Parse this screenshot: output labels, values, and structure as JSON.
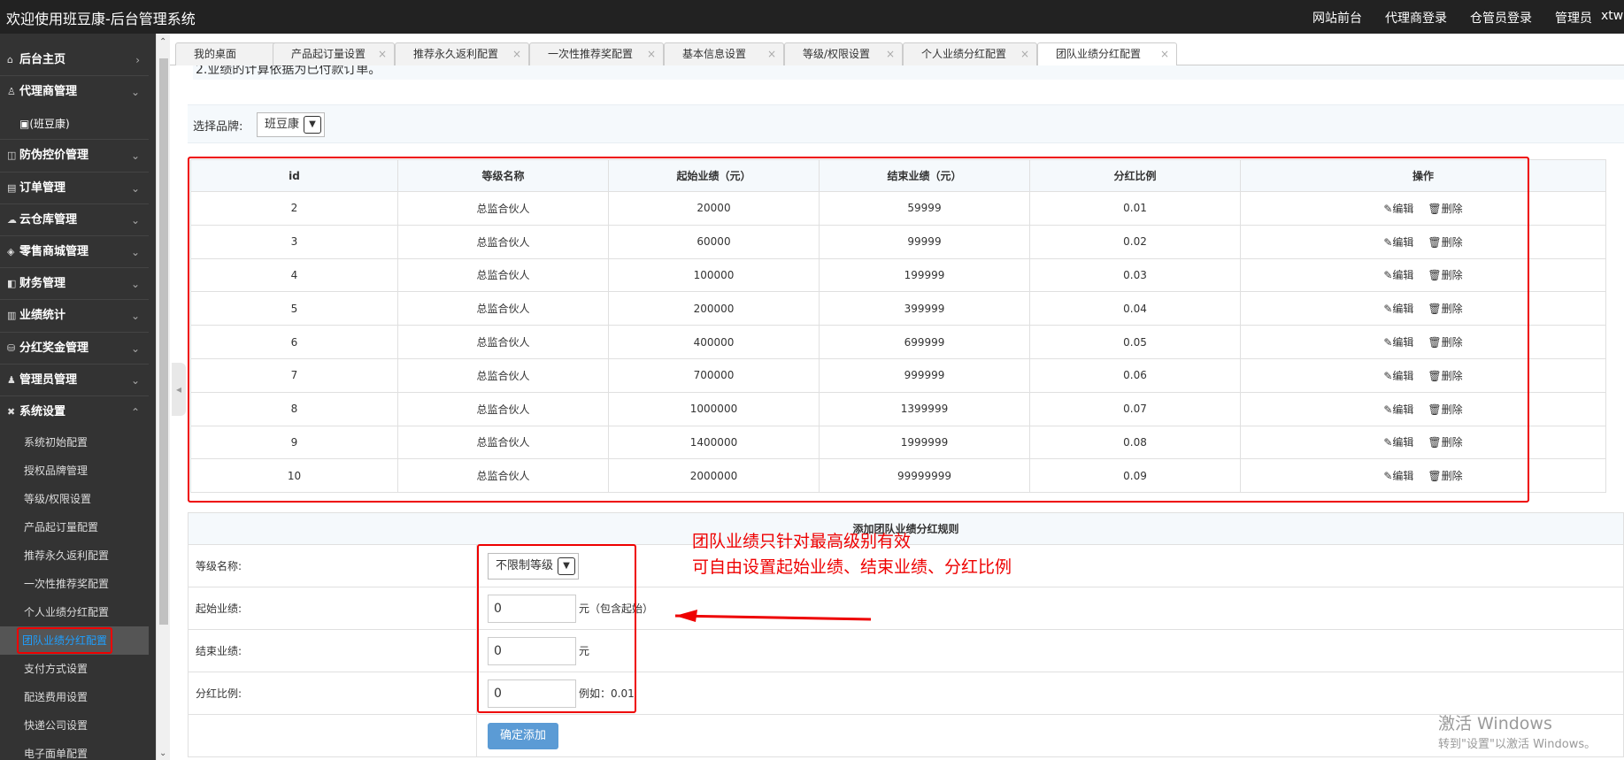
{
  "app": {
    "title": "欢迎使用班豆康-后台管理系统"
  },
  "topnav": [
    "网站前台",
    "代理商登录",
    "仓管员登录",
    "管理员"
  ],
  "user": "xtw",
  "menu": {
    "home": "后台主页",
    "agent": "代理商管理",
    "agent_sub": "(班豆康)",
    "anti": "防伪控价管理",
    "order": "订单管理",
    "cloud": "云仓库管理",
    "retail": "零售商城管理",
    "finance": "财务管理",
    "perf": "业绩统计",
    "bonus": "分红奖金管理",
    "admin": "管理员管理",
    "system": "系统设置",
    "sys_items": [
      "系统初始配置",
      "授权品牌管理",
      "等级/权限设置",
      "产品起订量配置",
      "推荐永久返利配置",
      "一次性推荐奖配置",
      "个人业绩分红配置",
      "团队业绩分红配置",
      "支付方式设置",
      "配送费用设置",
      "快递公司设置",
      "电子面单配置"
    ]
  },
  "tabs": [
    "我的桌面",
    "产品起订量设置",
    "推荐永久返利配置",
    "一次性推荐奖配置",
    "基本信息设置",
    "等级/权限设置",
    "个人业绩分红配置",
    "团队业绩分红配置"
  ],
  "note": "2.业绩的计算依据为已付款订单。",
  "brand": {
    "label": "选择品牌:",
    "value": "班豆康"
  },
  "table": {
    "headers": [
      "id",
      "等级名称",
      "起始业绩（元）",
      "结束业绩（元）",
      "分红比例",
      "操作"
    ],
    "edit": "编辑",
    "del": "删除",
    "rows": [
      [
        "2",
        "总监合伙人",
        "20000",
        "59999",
        "0.01"
      ],
      [
        "3",
        "总监合伙人",
        "60000",
        "99999",
        "0.02"
      ],
      [
        "4",
        "总监合伙人",
        "100000",
        "199999",
        "0.03"
      ],
      [
        "5",
        "总监合伙人",
        "200000",
        "399999",
        "0.04"
      ],
      [
        "6",
        "总监合伙人",
        "400000",
        "699999",
        "0.05"
      ],
      [
        "7",
        "总监合伙人",
        "700000",
        "999999",
        "0.06"
      ],
      [
        "8",
        "总监合伙人",
        "1000000",
        "1399999",
        "0.07"
      ],
      [
        "9",
        "总监合伙人",
        "1400000",
        "1999999",
        "0.08"
      ],
      [
        "10",
        "总监合伙人",
        "2000000",
        "99999999",
        "0.09"
      ]
    ]
  },
  "form": {
    "title": "添加团队业绩分红规则",
    "level_label": "等级名称:",
    "level_value": "不限制等级",
    "start_label": "起始业绩:",
    "start_value": "0",
    "start_hint": "元（包含起始）",
    "end_label": "结束业绩:",
    "end_value": "0",
    "end_hint": "元",
    "ratio_label": "分红比例:",
    "ratio_value": "0",
    "ratio_hint": "例如：0.01",
    "submit": "确定添加"
  },
  "annotation": {
    "line1": "团队业绩只针对最高级别有效",
    "line2": "可自由设置起始业绩、结束业绩、分红比例"
  },
  "watermark": {
    "line1": "激活 Windows",
    "line2": "转到\"设置\"以激活 Windows。"
  }
}
